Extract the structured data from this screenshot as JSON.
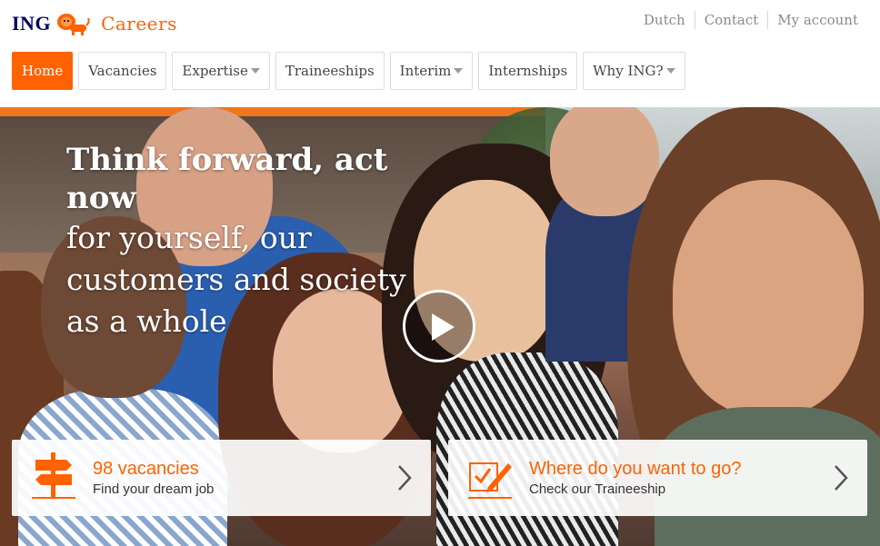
{
  "brand": {
    "name": "ING",
    "section": "Careers",
    "color_primary": "#ff6200",
    "color_navy": "#000066"
  },
  "utility_nav": [
    {
      "label": "Dutch"
    },
    {
      "label": "Contact"
    },
    {
      "label": "My account"
    }
  ],
  "main_nav": [
    {
      "label": "Home",
      "active": true,
      "dropdown": false
    },
    {
      "label": "Vacancies",
      "active": false,
      "dropdown": false
    },
    {
      "label": "Expertise",
      "active": false,
      "dropdown": true
    },
    {
      "label": "Traineeships",
      "active": false,
      "dropdown": false
    },
    {
      "label": "Interim",
      "active": false,
      "dropdown": true
    },
    {
      "label": "Internships",
      "active": false,
      "dropdown": false
    },
    {
      "label": "Why ING?",
      "active": false,
      "dropdown": true
    }
  ],
  "hero": {
    "headline_bold": "Think forward, act now",
    "headline_light": "for yourself, our customers and society as a whole",
    "play_icon": "play-icon"
  },
  "cta_cards": [
    {
      "title": "98 vacancies",
      "subtitle": "Find your dream job",
      "icon": "signpost-icon"
    },
    {
      "title": "Where do you want to go?",
      "subtitle": "Check our Traineeship",
      "icon": "checklist-pen-icon"
    }
  ]
}
